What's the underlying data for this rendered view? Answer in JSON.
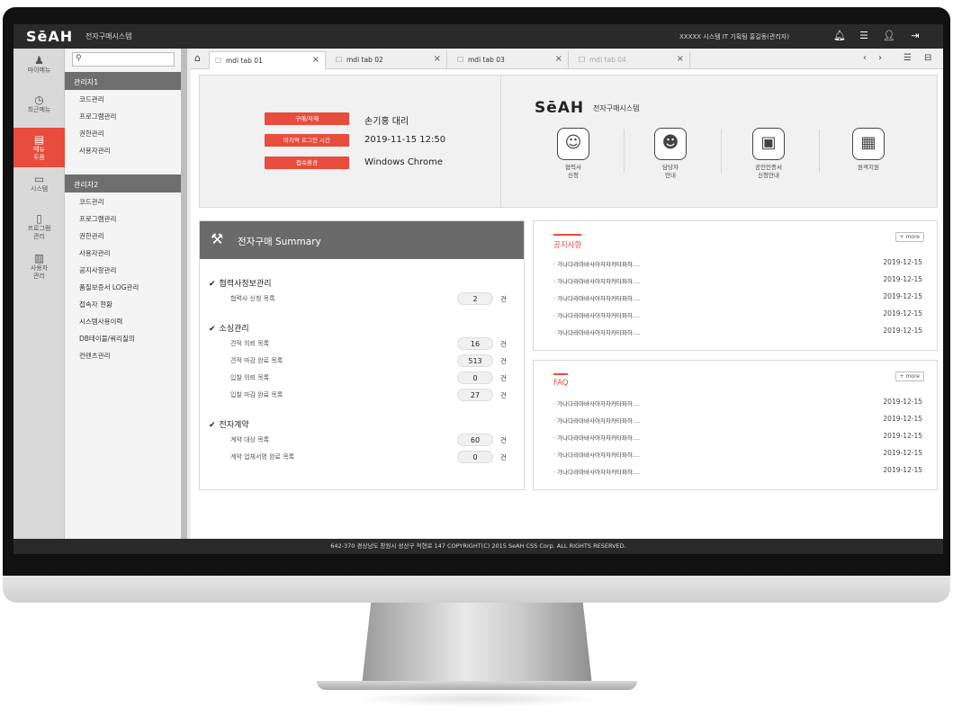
{
  "app": {
    "logo": "SēAH",
    "logo_sub": "전자구매시스템",
    "user_info": "XXXXX 시스템 IT 기획팀 홍길동(관리자)"
  },
  "rail": [
    {
      "label": "마이메뉴",
      "icon": "user-menu-icon",
      "glyph": "♟"
    },
    {
      "label": "최근메뉴",
      "icon": "clock-icon",
      "glyph": "◷"
    },
    {
      "label": "메뉴\n두음",
      "icon": "menu-box-icon",
      "glyph": "▤",
      "active": true
    },
    {
      "label": "시스템",
      "icon": "monitor-icon",
      "glyph": "▭"
    },
    {
      "label": "프로그램\n관리",
      "icon": "document-icon",
      "glyph": "▯"
    },
    {
      "label": "사용자\n관리",
      "icon": "chart-icon",
      "glyph": "▥"
    }
  ],
  "menu": {
    "search_placeholder": "",
    "group1": "관리자1",
    "group1_items": [
      "코드관리",
      "프로그램관리",
      "권한관리",
      "사용자관리"
    ],
    "group2": "관리자2",
    "group2_items": [
      "코드관리",
      "프로그램관리",
      "권한관리",
      "사용자관리",
      "공지사항관리",
      "품질보증서 LOG관리",
      "접속자 현황",
      "시스템사용이력",
      "DB테이블/쿼리질의",
      "컨텐츠관리"
    ]
  },
  "tabs": [
    {
      "label": "mdi tab 01",
      "active": true
    },
    {
      "label": "mdi tab 02"
    },
    {
      "label": "mdi tab 03"
    },
    {
      "label": "mdi tab 04",
      "dim": true
    }
  ],
  "info": {
    "purchase_label": "구매/자재",
    "purchase_value": "손기홍 대리",
    "last_login_label": "마지막 로그인 시간",
    "last_login_value": "2019-11-15 12:50",
    "env_label": "접속환경",
    "env_value": "Windows Chrome"
  },
  "services": [
    {
      "label": "협력사\n신청",
      "icon": "worker-icon",
      "glyph": "☺"
    },
    {
      "label": "담당자\n안내",
      "icon": "agent-icon",
      "glyph": "☻"
    },
    {
      "label": "공인인증서\n신청안내",
      "icon": "certificate-icon",
      "glyph": "▣"
    },
    {
      "label": "원격지원",
      "icon": "remote-support-icon",
      "glyph": "▦"
    }
  ],
  "summary": {
    "title": "전자구매 Summary",
    "unit": "건",
    "sections": [
      {
        "title": "협력사정보관리",
        "rows": [
          {
            "label": "협력사 신청 목록",
            "value": "2"
          }
        ]
      },
      {
        "title": "소싱관리",
        "rows": [
          {
            "label": "견적 의뢰 목록",
            "value": "16"
          },
          {
            "label": "견적 마감 완료 목록",
            "value": "513"
          },
          {
            "label": "입찰 의뢰 목록",
            "value": "0"
          },
          {
            "label": "입찰 마감 완료 목록",
            "value": "27"
          }
        ]
      },
      {
        "title": "전자계약",
        "rows": [
          {
            "label": "계약 대상 목록",
            "value": "60"
          },
          {
            "label": "계약 업체서명 완료 목록",
            "value": "0"
          }
        ]
      }
    ]
  },
  "notice": {
    "title": "공지사항",
    "more": "+ more",
    "items": [
      {
        "text": "· 가나다라마바사아자차카타파하....",
        "date": "2019-12-15"
      },
      {
        "text": "· 가나다라마바사아자차카타파하....",
        "date": "2019-12-15"
      },
      {
        "text": "· 가나다라마바사아자차카타파하....",
        "date": "2019-12-15"
      },
      {
        "text": "· 가나다라마바사아자차카타파하....",
        "date": "2019-12-15"
      },
      {
        "text": "· 가나다라마바사아자차카타파하....",
        "date": "2019-12-15"
      }
    ]
  },
  "faq": {
    "title": "FAQ",
    "more": "+ more",
    "items": [
      {
        "text": "· 가나다라마바사아자차카타파하....",
        "date": "2019-12-15"
      },
      {
        "text": "· 가나다라마바사아자차카타파하....",
        "date": "2019-12-15"
      },
      {
        "text": "· 가나다라마바사아자차카타파하....",
        "date": "2019-12-15"
      },
      {
        "text": "· 가나다라마바사아자차카타파하....",
        "date": "2019-12-15"
      },
      {
        "text": "· 가나다라마바사아자차카타파하....",
        "date": "2019-12-15"
      }
    ]
  },
  "footer": "642-370 경상남도 창원시 성산구 적현로 147 COPYRIGHT(C) 2015 SeAH CSS Corp. ALL RIGHTS RESERVED.",
  "colors": {
    "accent": "#e74c3c",
    "dark": "#2a2a2a"
  }
}
